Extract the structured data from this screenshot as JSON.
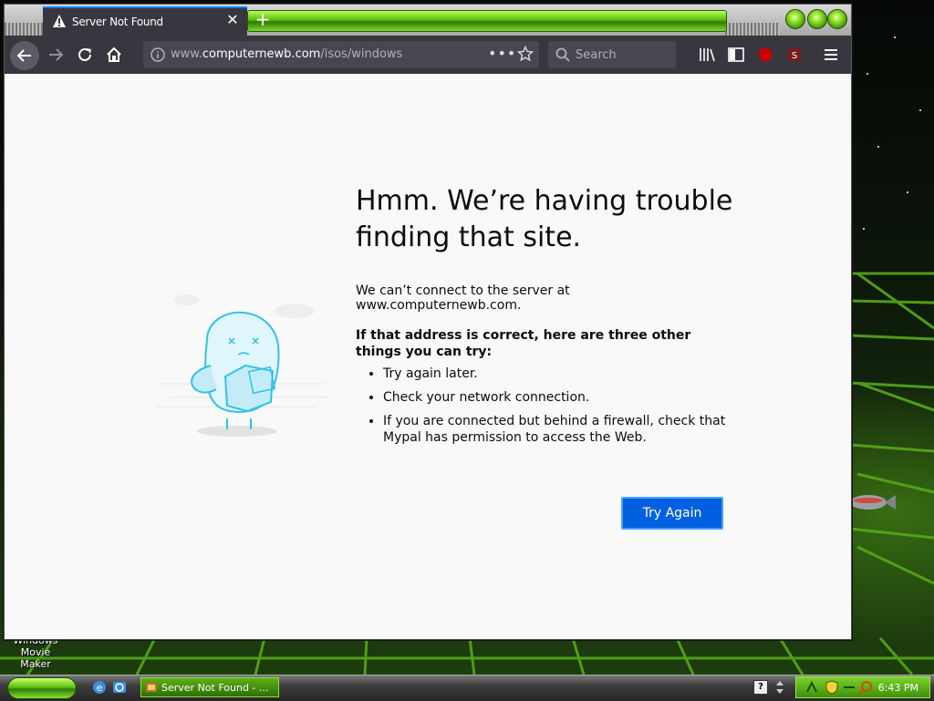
{
  "browser": {
    "tab": {
      "title": "Server Not Found",
      "icon": "warning-icon"
    },
    "url": {
      "scheme_prefix": "www.",
      "domain": "computernewb.com",
      "path": "/isos/windows"
    },
    "search_placeholder": "Search"
  },
  "error_page": {
    "title": "Hmm. We’re having trouble finding that site.",
    "description": "We can’t connect to the server at www.computernewb.com.",
    "subtitle": "If that address is correct, here are three other things you can try:",
    "tips": [
      "Try again later.",
      "Check your network connection.",
      "If you are connected but behind a firewall, check that Mypal has permission to access the Web."
    ],
    "button_label": "Try Again",
    "accent_color": "#0060df"
  },
  "desktop": {
    "icon_label_line1": "Windows Movie",
    "icon_label_line2": "Maker"
  },
  "taskbar": {
    "task_label": "Server Not Found - ...",
    "clock": "6:43 PM"
  }
}
